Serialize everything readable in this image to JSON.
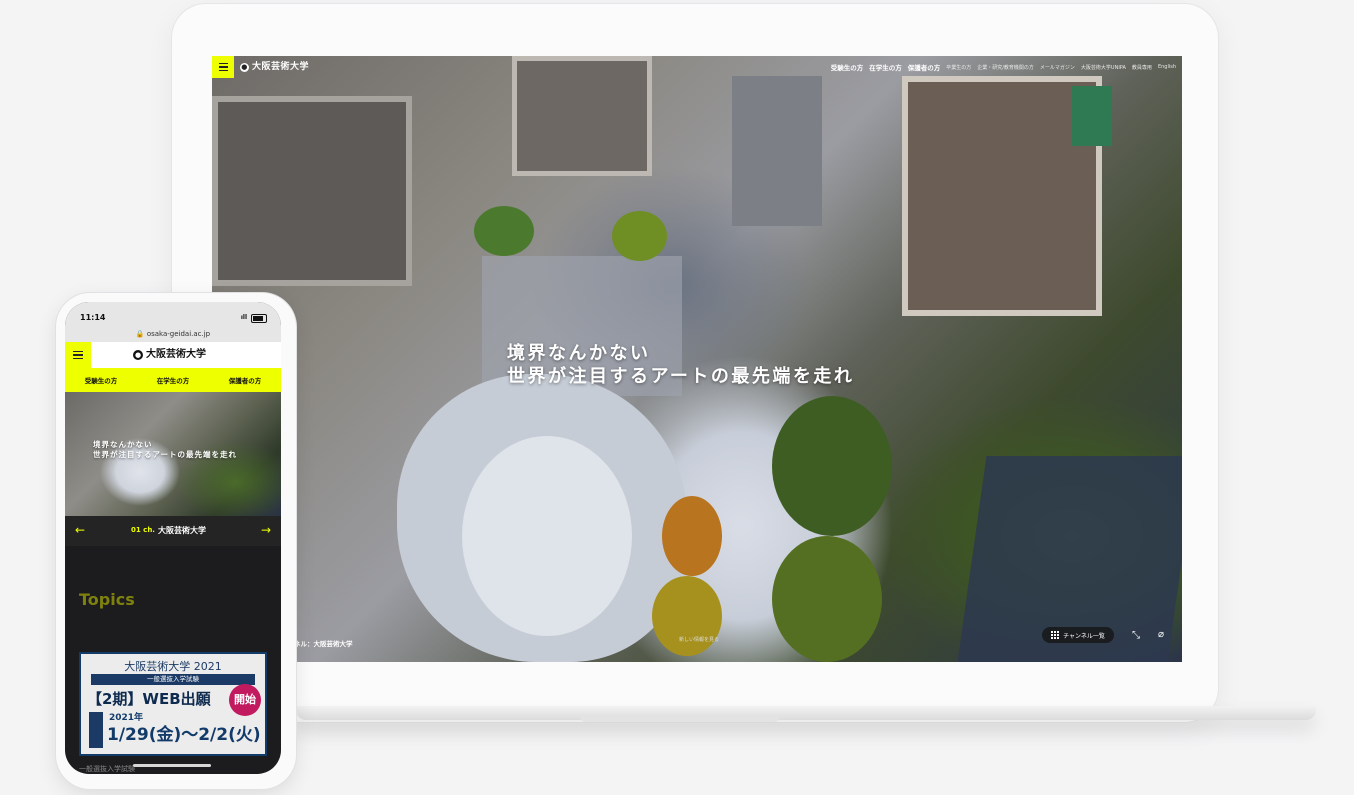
{
  "desktop": {
    "logo": "大阪芸術大学",
    "nav_main": [
      "受験生の方",
      "在学生の方",
      "保護者の方"
    ],
    "nav_sub": [
      "卒業生の方",
      "企業・研究/教育機関の方",
      "メールマガジン",
      "大阪芸術大学UNIPA",
      "教員専用",
      "English"
    ],
    "hero_line1": "境界なんかない",
    "hero_line2": "世界が注目するアートの最先端を走れ",
    "channel_label": "ネル：大阪芸術大学",
    "center_label": "新しい情報を見る",
    "channel_list_button": "チャンネル一覧"
  },
  "mobile": {
    "time": "11:14",
    "url": "osaka-geidai.ac.jp",
    "logo": "大阪芸術大学",
    "tabs": [
      "受験生の方",
      "在学生の方",
      "保護者の方"
    ],
    "hero_line1": "境界なんかない",
    "hero_line2": "世界が注目するアートの最先端を走れ",
    "channel_num": "01 ch.",
    "channel_name": "大阪芸術大学",
    "topics": "Topics",
    "ad": {
      "title": "大阪芸術大学 2021",
      "subtitle": "一般選抜入学試験",
      "headline": "【2期】WEB出願",
      "badge": "開始",
      "year": "2021年",
      "dates": "1/29(金)〜2/2(火)"
    },
    "bottom_text": "一般選抜入学試験"
  },
  "colors": {
    "accent_yellow": "#eeff00",
    "ad_navy": "#123b6a",
    "badge_magenta": "#c21a5f"
  }
}
